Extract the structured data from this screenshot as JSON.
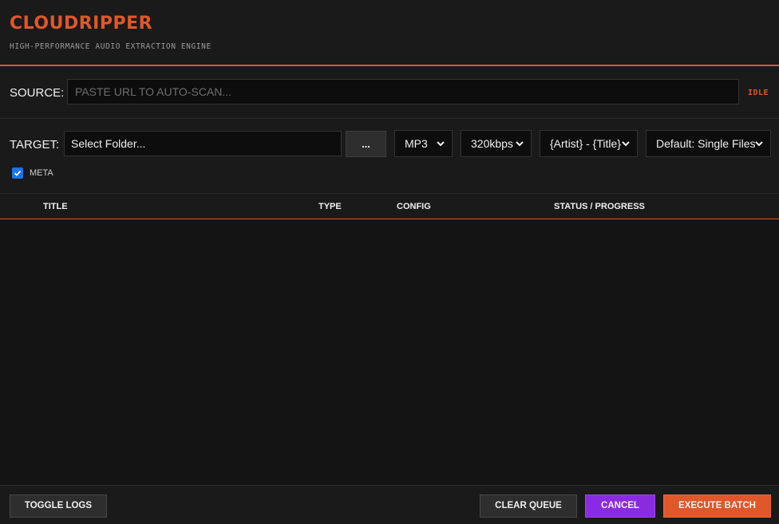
{
  "header": {
    "brand": "CLOUDRIPPER",
    "tagline": "HIGH-PERFORMANCE AUDIO EXTRACTION ENGINE"
  },
  "source": {
    "label": "SOURCE:",
    "placeholder": "PASTE URL TO AUTO-SCAN...",
    "value": "",
    "status": "IDLE"
  },
  "target": {
    "label": "TARGET:",
    "folder_value": "Select Folder...",
    "browse_label": "...",
    "format": {
      "selected": "MP3"
    },
    "bitrate": {
      "selected": "320kbps"
    },
    "naming": {
      "selected": "{Artist} - {Title}"
    },
    "mode": {
      "selected": "Default: Single Files"
    },
    "meta": {
      "label": "META",
      "checked": true
    }
  },
  "table": {
    "columns": [
      "TITLE",
      "TYPE",
      "CONFIG",
      "STATUS / PROGRESS"
    ],
    "rows": []
  },
  "footer": {
    "toggle_logs": "TOGGLE LOGS",
    "clear_queue": "CLEAR QUEUE",
    "cancel": "CANCEL",
    "execute": "EXECUTE BATCH"
  },
  "colors": {
    "accent": "#e0572a",
    "cancel": "#8a2be2",
    "background": "#141414",
    "panel": "#1a1a1a",
    "checkbox": "#1a73e8"
  }
}
